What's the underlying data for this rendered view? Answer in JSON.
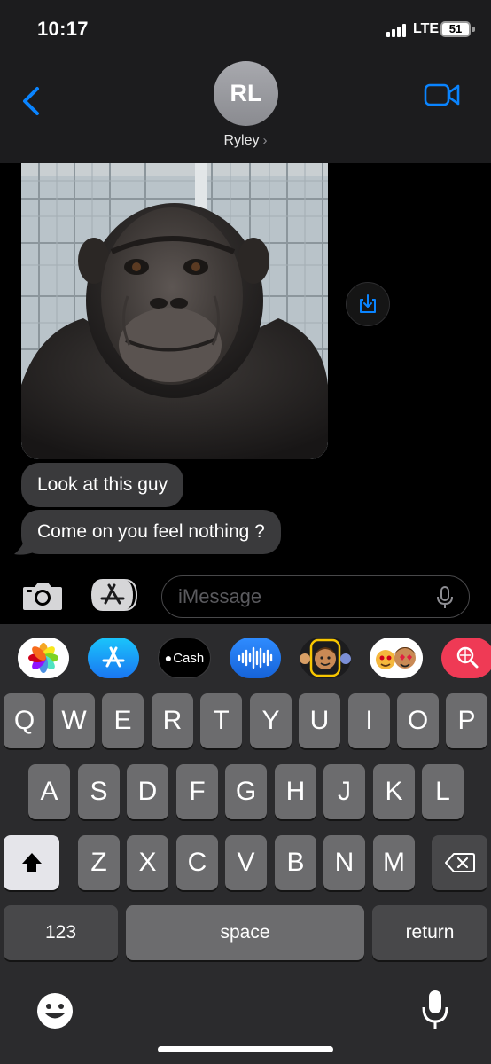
{
  "status_bar": {
    "time": "10:17",
    "network": "LTE",
    "battery": "51"
  },
  "header": {
    "avatar_initials": "RL",
    "contact_name": "Ryley",
    "chevron": "›"
  },
  "messages": [
    {
      "type": "image",
      "subject": "ape photo"
    },
    {
      "type": "text",
      "text": "Look at this guy"
    },
    {
      "type": "text",
      "text": "Come on you feel nothing ?"
    }
  ],
  "compose": {
    "placeholder": "iMessage"
  },
  "app_strip": [
    {
      "name": "photos-icon"
    },
    {
      "name": "app-store-icon"
    },
    {
      "name": "cash-icon",
      "label": "Cash"
    },
    {
      "name": "audio-message-icon"
    },
    {
      "name": "memoji-icon"
    },
    {
      "name": "memoji-stickers-icon"
    },
    {
      "name": "web-search-icon"
    }
  ],
  "keyboard": {
    "row1": [
      "Q",
      "W",
      "E",
      "R",
      "T",
      "Y",
      "U",
      "I",
      "O",
      "P"
    ],
    "row2": [
      "A",
      "S",
      "D",
      "F",
      "G",
      "H",
      "J",
      "K",
      "L"
    ],
    "row3": [
      "Z",
      "X",
      "C",
      "V",
      "B",
      "N",
      "M"
    ],
    "numbers_label": "123",
    "space_label": "space",
    "return_label": "return"
  },
  "colors": {
    "accent": "#0a84ff",
    "bubble": "#3a3a3c",
    "bar": "#1c1c1e"
  }
}
